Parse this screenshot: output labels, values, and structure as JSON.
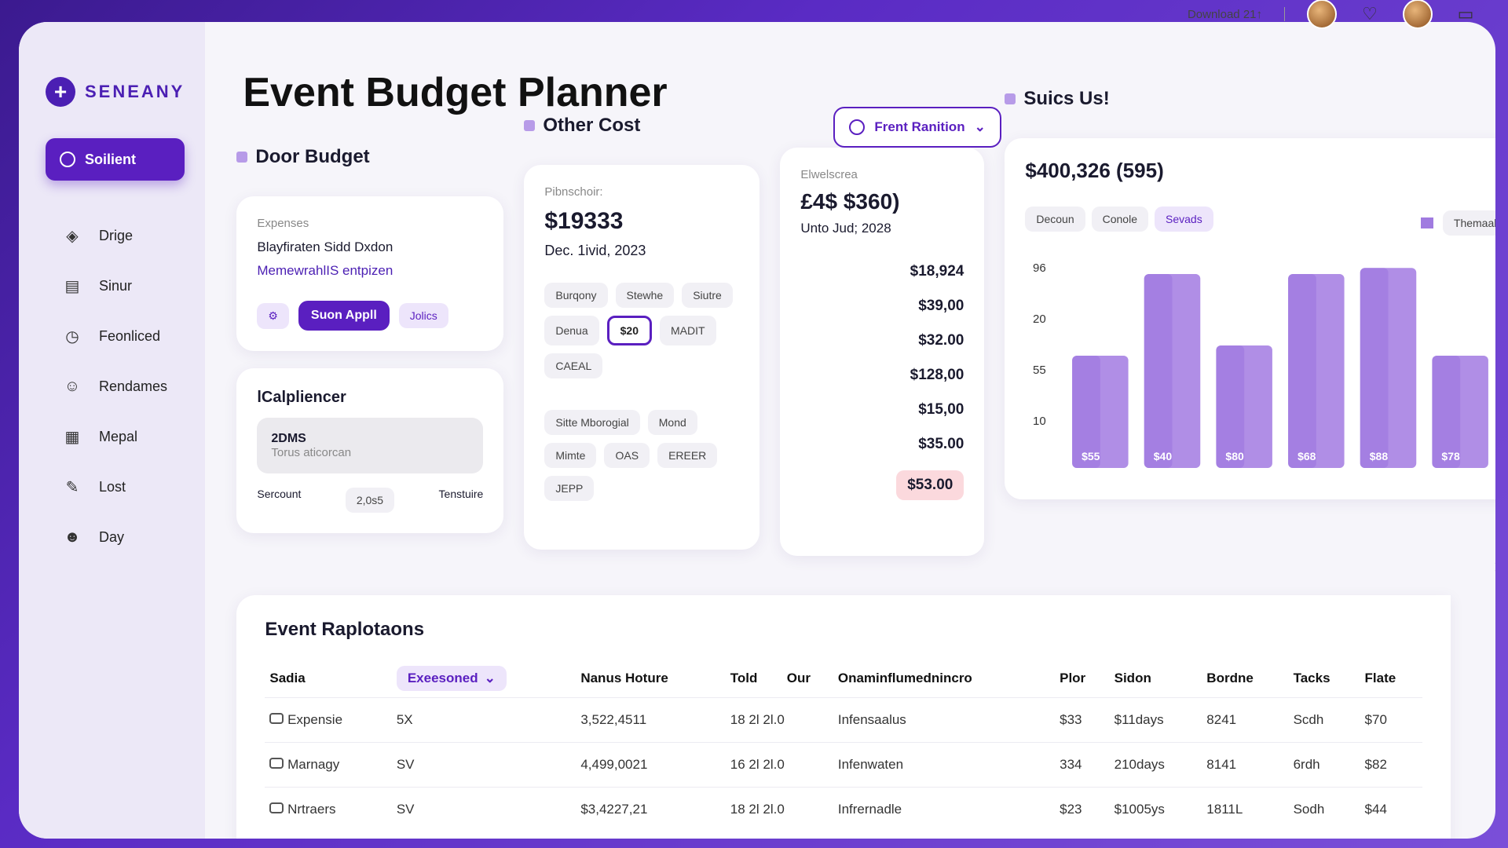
{
  "topbar": {
    "download": "Download 21↑"
  },
  "brand": {
    "name": "SENEANY"
  },
  "sidebar": {
    "primary": "Soilient",
    "items": [
      {
        "label": "Drige",
        "icon": "diamond-icon"
      },
      {
        "label": "Sinur",
        "icon": "list-icon"
      },
      {
        "label": "Feonliced",
        "icon": "clock-icon"
      },
      {
        "label": "Rendames",
        "icon": "face-icon"
      },
      {
        "label": "Mepal",
        "icon": "calendar-icon"
      },
      {
        "label": "Lost",
        "icon": "pen-icon"
      },
      {
        "label": "Day",
        "icon": "smile-icon"
      }
    ]
  },
  "page": {
    "title": "Event Budget Planner"
  },
  "door_budget": {
    "heading": "Door Budget",
    "label": "Expenses",
    "line1": "Blayfiraten Sidd Dxdon",
    "line2": "MemewrahlIS entpizen",
    "btn": "Suon Appll",
    "chip": "Jolics"
  },
  "calpliencer": {
    "heading": "lCalpliencer",
    "box_title": "2DMS",
    "box_sub": "Torus aticorcan",
    "f1": "Sercount",
    "f2": "2,0s5",
    "f3": "Tenstuire"
  },
  "other_cost": {
    "heading": "Other Cost",
    "label": "Pibnschoir:",
    "amount": "$19333",
    "date": "Dec. 1ivid, 2023",
    "chips": [
      "Burqony",
      "Stewhe",
      "Siutre",
      "Denua",
      "$20",
      "MADIT",
      "CAEAL",
      "Sitte Mborogial",
      "Mond",
      "Mimte",
      "OAS",
      "EREER",
      "JEPP"
    ]
  },
  "dropdown": {
    "label": "Frent Ranition"
  },
  "elwelscrea": {
    "label": "Elwelscrea",
    "amount": "£4$ $360)",
    "date": "Unto Jud; 2028",
    "amounts": [
      "$18,924",
      "$39,00",
      "$32.00",
      "$128,00",
      "$15,00",
      "$35.00",
      "$53.00"
    ]
  },
  "summary": {
    "heading": "Suics Us!",
    "total": "$400,326 (595)",
    "tabs": [
      "Decoun",
      "Conole",
      "Sevads"
    ],
    "legend": "Themaal"
  },
  "chart_data": {
    "type": "bar",
    "yticks": [
      "96",
      "20",
      "55",
      "10"
    ],
    "values": [
      55,
      95,
      60,
      95,
      98,
      55
    ],
    "labels": [
      "$55",
      "$40",
      "$80",
      "$68",
      "$88",
      "$78"
    ],
    "colors": {
      "bar": "#b08ee6",
      "bar_shade": "#9b72de"
    }
  },
  "table": {
    "title": "Event Raplotaons",
    "headers": [
      "Sadia",
      "Exeesoned",
      "Nanus Hoture",
      "Told",
      "Our",
      "Onaminflumednincro",
      "Plor",
      "Sidon",
      "Bordne",
      "Tacks",
      "Flate"
    ],
    "rows": [
      [
        "Expensie",
        "5X",
        "3,522,4511",
        "18 2l 2l.0",
        "Infensaalus",
        "$33",
        "$11days",
        "8241",
        "Scdh",
        "$70"
      ],
      [
        "Marnagy",
        "SV",
        "4,499,0021",
        "16 2l 2l.0",
        "Infenwaten",
        "334",
        "210days",
        "8141",
        "6rdh",
        "$82"
      ],
      [
        "Nrtraers",
        "SV",
        "$3,4227,21",
        "18 2l 2l.0",
        "Infrernadle",
        "$23",
        "$1005ys",
        "1811L",
        "Sodh",
        "$44"
      ]
    ]
  }
}
